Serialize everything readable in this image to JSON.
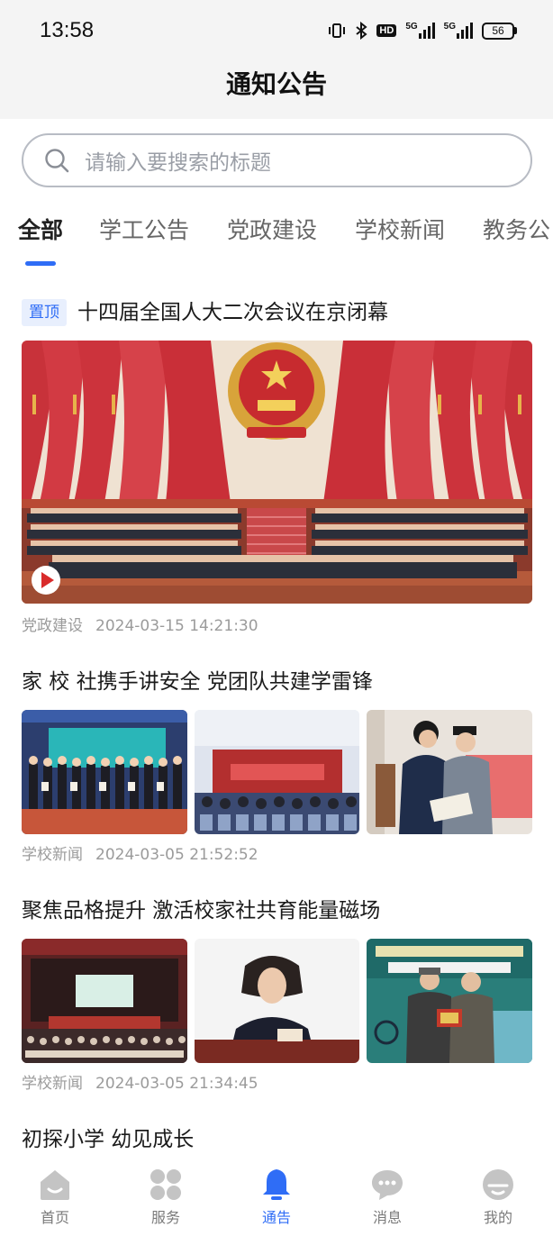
{
  "status_bar": {
    "time": "13:58",
    "hd": "HD",
    "network_1": "5G",
    "network_2": "5G",
    "battery": "56"
  },
  "header": {
    "title": "通知公告"
  },
  "search": {
    "placeholder": "请输入要搜索的标题"
  },
  "tabs": [
    {
      "label": "全部",
      "active": true
    },
    {
      "label": "学工公告"
    },
    {
      "label": "党政建设"
    },
    {
      "label": "学校新闻"
    },
    {
      "label": "教务公"
    }
  ],
  "news": [
    {
      "pinned_label": "置顶",
      "title": "十四届全国人大二次会议在京闭幕",
      "category": "党政建设",
      "datetime": "2024-03-15 14:21:30"
    },
    {
      "title": "家 校 社携手讲安全 党团队共建学雷锋",
      "category": "学校新闻",
      "datetime": "2024-03-05 21:52:52"
    },
    {
      "title": "聚焦品格提升 激活校家社共育能量磁场",
      "category": "学校新闻",
      "datetime": "2024-03-05 21:34:45"
    },
    {
      "title": "初探小学 幼见成长"
    }
  ],
  "tabbar": [
    {
      "label": "首页",
      "icon": "home-icon"
    },
    {
      "label": "服务",
      "icon": "grid-icon"
    },
    {
      "label": "通告",
      "icon": "bell-icon",
      "active": true
    },
    {
      "label": "消息",
      "icon": "chat-icon"
    },
    {
      "label": "我的",
      "icon": "profile-icon"
    }
  ],
  "colors": {
    "accent": "#2f6df6",
    "meta": "#9b9b9b",
    "tab_inactive": "#666666",
    "badge_bg": "#e8effd"
  }
}
